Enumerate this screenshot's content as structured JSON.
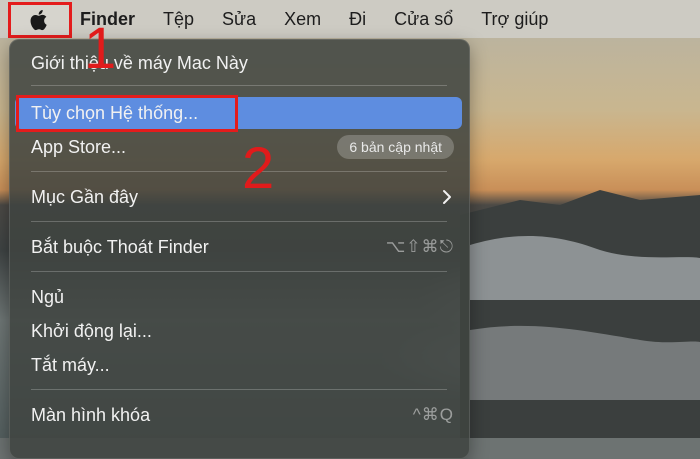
{
  "menubar": {
    "apple_icon": "apple-logo-icon",
    "items": [
      "Finder",
      "Tệp",
      "Sửa",
      "Xem",
      "Đi",
      "Cửa sổ",
      "Trợ giúp"
    ]
  },
  "apple_menu": {
    "about": "Giới thiệu về máy Mac Này",
    "system_prefs": "Tùy chọn Hệ thống...",
    "app_store": "App Store...",
    "app_store_badge": "6 bản cập nhật",
    "recent_items": "Mục Gần đây",
    "force_quit": "Bắt buộc Thoát Finder",
    "force_quit_shortcut": "⌥⇧⌘⎋",
    "sleep": "Ngủ",
    "restart": "Khởi động lại...",
    "shutdown": "Tắt máy...",
    "lock_screen": "Màn hình khóa",
    "lock_screen_shortcut": "^⌘Q"
  },
  "annotations": {
    "step1": "1",
    "step2": "2",
    "highlight_color": "#e41c1c"
  }
}
